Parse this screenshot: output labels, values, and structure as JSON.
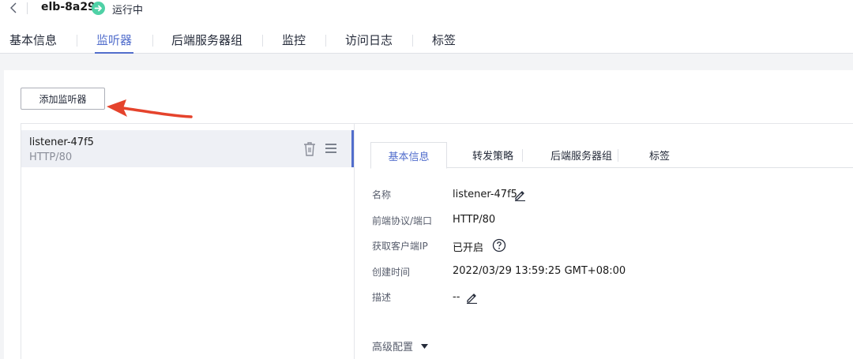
{
  "header": {
    "elb_name": "elb-8a29",
    "status": "运行中",
    "status_color": "#4fd1a6"
  },
  "main_tabs": [
    {
      "label": "基本信息",
      "active": false
    },
    {
      "label": "监听器",
      "active": true
    },
    {
      "label": "后端服务器组",
      "active": false
    },
    {
      "label": "监控",
      "active": false
    },
    {
      "label": "访问日志",
      "active": false
    },
    {
      "label": "标签",
      "active": false
    }
  ],
  "toolbar": {
    "add_listener_label": "添加监听器"
  },
  "listeners": [
    {
      "name": "listener-47f5",
      "protocol_port": "HTTP/80",
      "selected": true
    }
  ],
  "detail": {
    "tabs": [
      {
        "label": "基本信息",
        "active": true
      },
      {
        "label": "转发策略",
        "active": false
      },
      {
        "label": "后端服务器组",
        "active": false
      },
      {
        "label": "标签",
        "active": false
      }
    ],
    "fields": [
      {
        "label": "名称",
        "value": "listener-47f5"
      },
      {
        "label": "前端协议/端口",
        "value": "HTTP/80"
      },
      {
        "label": "获取客户端IP",
        "value": "已开启"
      },
      {
        "label": "创建时间",
        "value": "2022/03/29 13:59:25 GMT+08:00"
      },
      {
        "label": "描述",
        "value": "--"
      }
    ],
    "advanced_label": "高级配置"
  },
  "colors": {
    "accent": "#526ecc",
    "annotation_arrow": "#e5432c"
  },
  "icons": [
    "chevron-left-icon",
    "arrow-right-circle-icon",
    "trash-icon",
    "menu-icon",
    "pencil-icon",
    "question-circle-icon",
    "caret-down-icon"
  ]
}
